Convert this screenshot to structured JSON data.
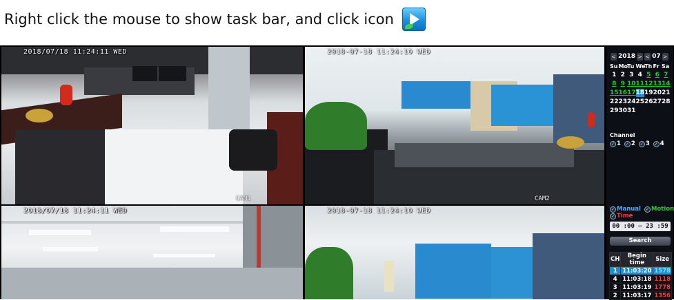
{
  "instruction": {
    "text": "Right click the mouse to show task bar, and click icon",
    "icon": "playback-icon"
  },
  "cameras": [
    {
      "timestamp": "2018/07/18 11:24:11 WED",
      "label": "CAM1"
    },
    {
      "timestamp": "2018-07-18 11:24:10 WED",
      "label": "CAM2"
    },
    {
      "timestamp": "2018/07/18 11:24:11 WED",
      "label": ""
    },
    {
      "timestamp": "2018-07-18 11:24:10 WED",
      "label": ""
    }
  ],
  "calendar": {
    "year": "2018",
    "month": "07",
    "weekday_header": [
      "Su",
      "Mo",
      "Tu",
      "We",
      "Th",
      "Fr",
      "Sa"
    ],
    "days": [
      [
        "",
        "",
        "",
        "",
        "",
        "",
        ""
      ],
      [
        "1",
        "2",
        "3",
        "4",
        "5",
        "6",
        "7"
      ],
      [
        "8",
        "9",
        "10",
        "11",
        "12",
        "13",
        "14"
      ],
      [
        "15",
        "16",
        "17",
        "18",
        "19",
        "20",
        "21"
      ],
      [
        "22",
        "23",
        "24",
        "25",
        "26",
        "27",
        "28"
      ],
      [
        "29",
        "30",
        "31",
        "",
        "",
        "",
        ""
      ]
    ],
    "record_days": [
      "5",
      "6",
      "7",
      "8",
      "9",
      "10",
      "11",
      "12",
      "13",
      "14",
      "15",
      "16",
      "17"
    ],
    "selected_day": "18",
    "record_color": "#1fd12d",
    "selected_color": "#1b8fd4"
  },
  "channel": {
    "title": "Channel",
    "items": [
      "1",
      "2",
      "3",
      "4"
    ]
  },
  "record_type": {
    "manual": "Manual",
    "motion": "Motion",
    "time": "Time",
    "manual_color": "#4aa8ff",
    "motion_color": "#22d12a",
    "time_color": "#ff3a3a"
  },
  "time_range": "00 :00 – 23 :59",
  "search_label": "Search",
  "results": {
    "columns": [
      "CH",
      "Begin time",
      "Size"
    ],
    "rows": [
      {
        "ch": "1",
        "time": "11:03:20",
        "size": "1578"
      },
      {
        "ch": "4",
        "time": "11:03:18",
        "size": "1118"
      },
      {
        "ch": "3",
        "time": "11:03:19",
        "size": "1778"
      },
      {
        "ch": "2",
        "time": "11:03:17",
        "size": "1356"
      }
    ]
  }
}
